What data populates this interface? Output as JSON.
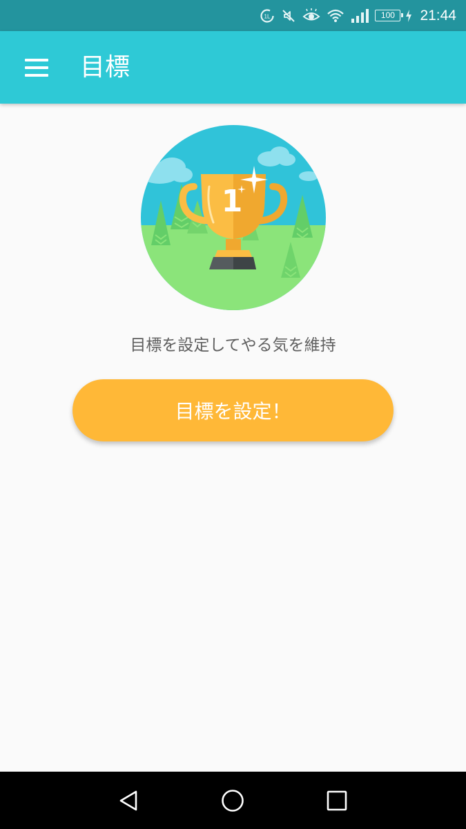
{
  "status_bar": {
    "time": "21:44",
    "battery": "100",
    "icons": [
      "data-saver-icon",
      "mute-icon",
      "eye-comfort-icon",
      "wifi-icon",
      "signal-icon",
      "battery-icon",
      "charging-icon"
    ]
  },
  "app_bar": {
    "title": "目標",
    "menu_icon": "menu-icon"
  },
  "hero": {
    "illustration": "trophy-illustration",
    "rank_number": "1"
  },
  "main": {
    "tagline": "目標を設定してやる気を維持",
    "cta_label": "目標を設定！"
  },
  "nav_bar": {
    "icons": [
      "back-icon",
      "home-icon",
      "recents-icon"
    ]
  },
  "colors": {
    "status_bar": "#23949e",
    "app_bar": "#2ec9d6",
    "cta": "#ffb837",
    "background": "#fafafa",
    "sky": "#30c3d9",
    "grass": "#8be47a",
    "trophy": "#fbbd44"
  }
}
